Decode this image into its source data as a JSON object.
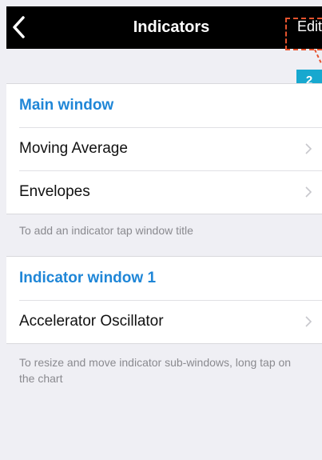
{
  "navbar": {
    "title": "Indicators",
    "edit_label": "Edit",
    "back_icon": "chevron-left-icon"
  },
  "annotation": {
    "step_number": "2",
    "highlight_color": "#e6532e",
    "badge_color": "#17a8cf"
  },
  "main_window": {
    "header": "Main window",
    "items": [
      {
        "label": "Moving Average"
      },
      {
        "label": "Envelopes"
      }
    ],
    "note": "To add an indicator tap window title"
  },
  "indicator_window": {
    "header": "Indicator window 1",
    "items": [
      {
        "label": "Accelerator Oscillator"
      }
    ],
    "note": "To resize and move indicator sub-windows, long tap on the chart"
  },
  "colors": {
    "accent": "#1f86d7",
    "background": "#efeff4",
    "navbar": "#000000"
  }
}
